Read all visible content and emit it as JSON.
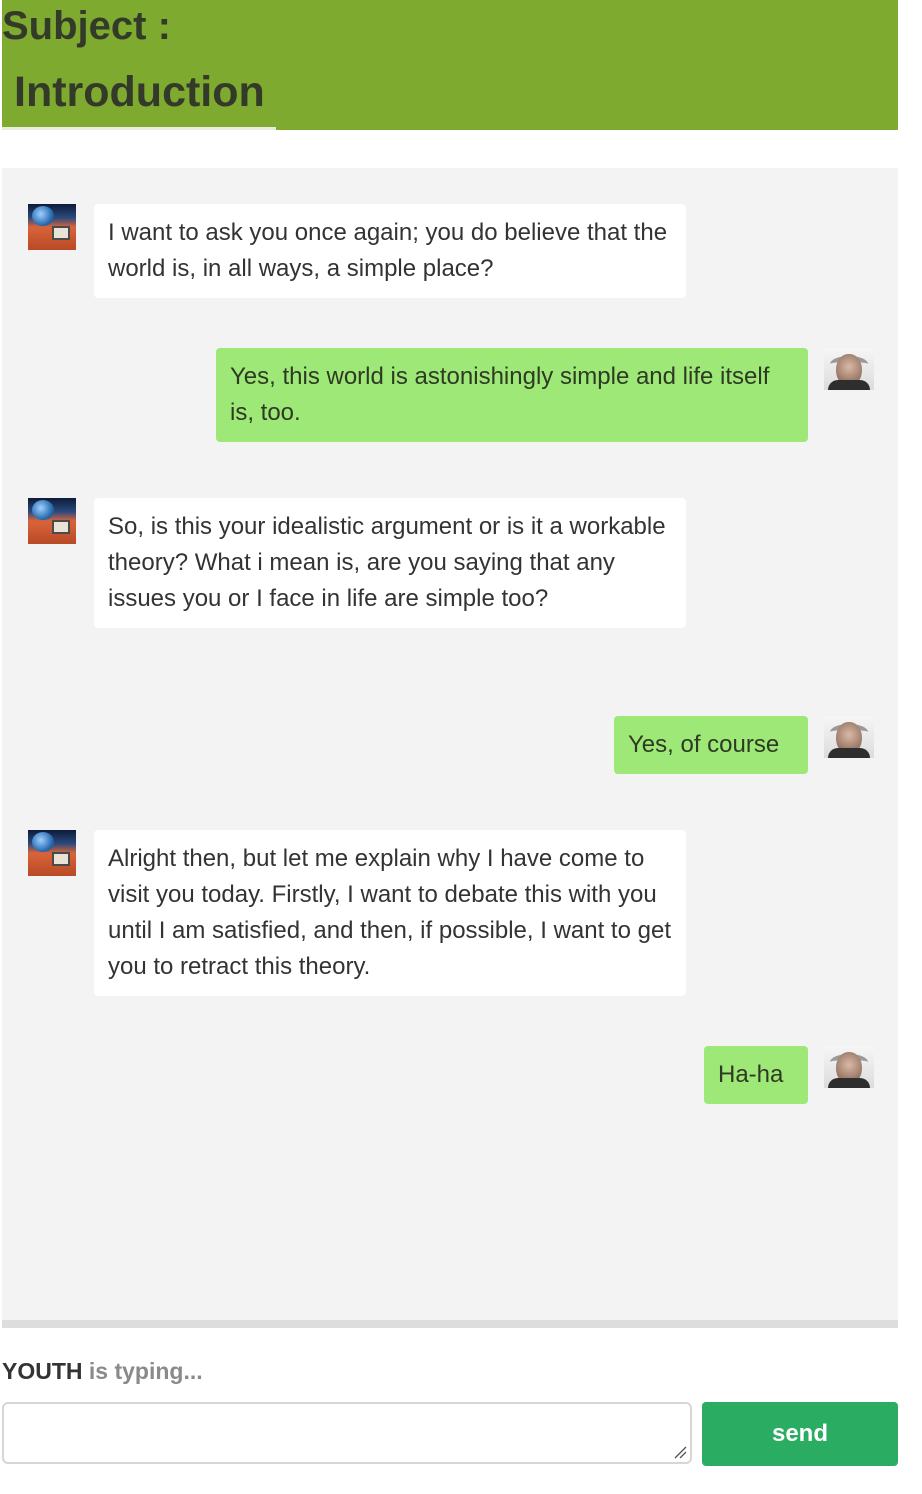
{
  "header": {
    "subject_label": "Subject :",
    "subject_value": "Introduction"
  },
  "colors": {
    "header_bg": "#7eab2f",
    "own_bubble": "#9de876",
    "other_bubble": "#ffffff",
    "chat_bg": "#f3f3f3",
    "send_button": "#2bac63"
  },
  "messages": [
    {
      "sender": "youth",
      "side": "left",
      "avatar": "youth-avatar",
      "text": "I want to ask you once again; you do believe that the world is, in all ways, a simple place?"
    },
    {
      "sender": "philosopher",
      "side": "right",
      "avatar": "philosopher-avatar",
      "text": "Yes, this world is astonishingly simple and life itself is, too."
    },
    {
      "sender": "youth",
      "side": "left",
      "avatar": "youth-avatar",
      "text": "So, is this your idealistic argument or is it a workable theory? What i mean is, are you saying that any issues you or I face in life are simple too?"
    },
    {
      "sender": "philosopher",
      "side": "right",
      "avatar": "philosopher-avatar",
      "text": "Yes, of course"
    },
    {
      "sender": "youth",
      "side": "left",
      "avatar": "youth-avatar",
      "text": "Alright then, but let me explain why I have come to visit you today. Firstly, I want to debate this with you until I am satisfied, and then, if possible, I want to get you to retract this theory."
    },
    {
      "sender": "philosopher",
      "side": "right",
      "avatar": "philosopher-avatar",
      "text": "Ha-ha"
    }
  ],
  "typing": {
    "who": "YOUTH",
    "what": " is typing..."
  },
  "composer": {
    "value": "",
    "placeholder": "",
    "send_label": "send"
  }
}
